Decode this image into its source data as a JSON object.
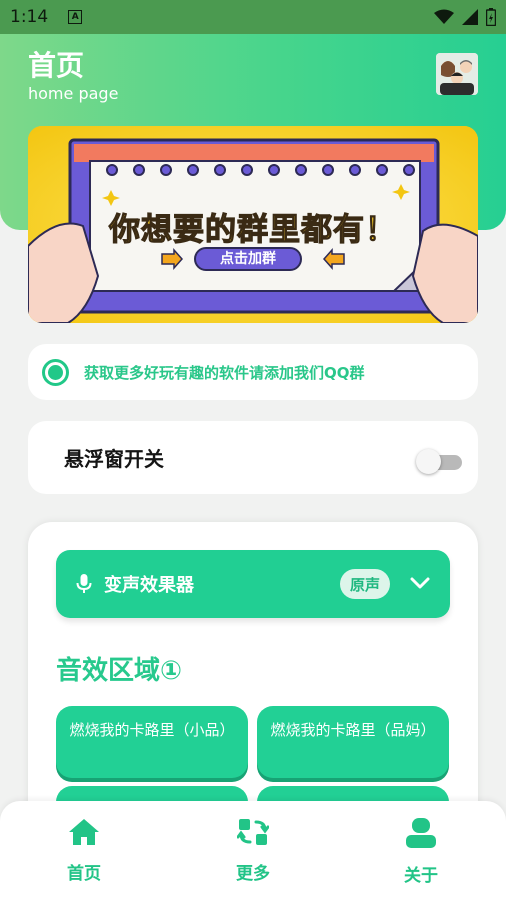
{
  "status_bar": {
    "time": "1:14"
  },
  "header": {
    "title": "首页",
    "subtitle": "home page"
  },
  "banner": {
    "headline": "你想要的群里都有！",
    "button_label": "点击加群"
  },
  "notice": {
    "text": "获取更多好玩有趣的软件请添加我们QQ群"
  },
  "floating_window": {
    "label": "悬浮窗开关",
    "enabled": false
  },
  "voice_changer": {
    "title": "变声效果器",
    "mode": "原声",
    "section_title": "音效区域①",
    "sounds": [
      {
        "label": "燃烧我的卡路里（小品）"
      },
      {
        "label": "燃烧我的卡路里（品妈）"
      }
    ]
  },
  "bottom_nav": {
    "items": [
      {
        "label": "首页",
        "icon": "home-icon"
      },
      {
        "label": "更多",
        "icon": "swap-icon"
      },
      {
        "label": "关于",
        "icon": "user-icon"
      }
    ]
  },
  "colors": {
    "accent": "#21cf93",
    "status_bar": "#4b9a50"
  }
}
